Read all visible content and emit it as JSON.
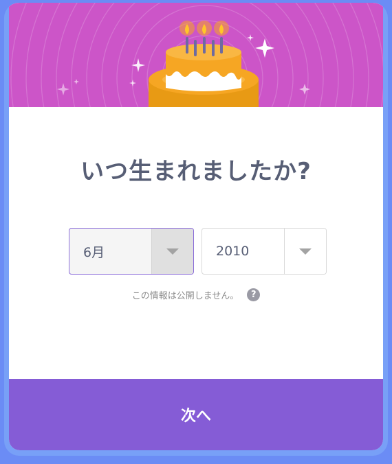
{
  "dialog": {
    "title": "いつ生まれましたか?",
    "month_select": {
      "value": "6月",
      "icon": "chevron-down-icon"
    },
    "year_select": {
      "value": "2010",
      "icon": "chevron-down-icon"
    },
    "privacy_note": "この情報は公開しません。",
    "help_icon_glyph": "?",
    "next_button": "次へ"
  },
  "colors": {
    "banner": "#cc55c8",
    "cake": "#f6a623",
    "title": "#575e75",
    "accent": "#855cd6",
    "frame": "#78a0f7"
  }
}
